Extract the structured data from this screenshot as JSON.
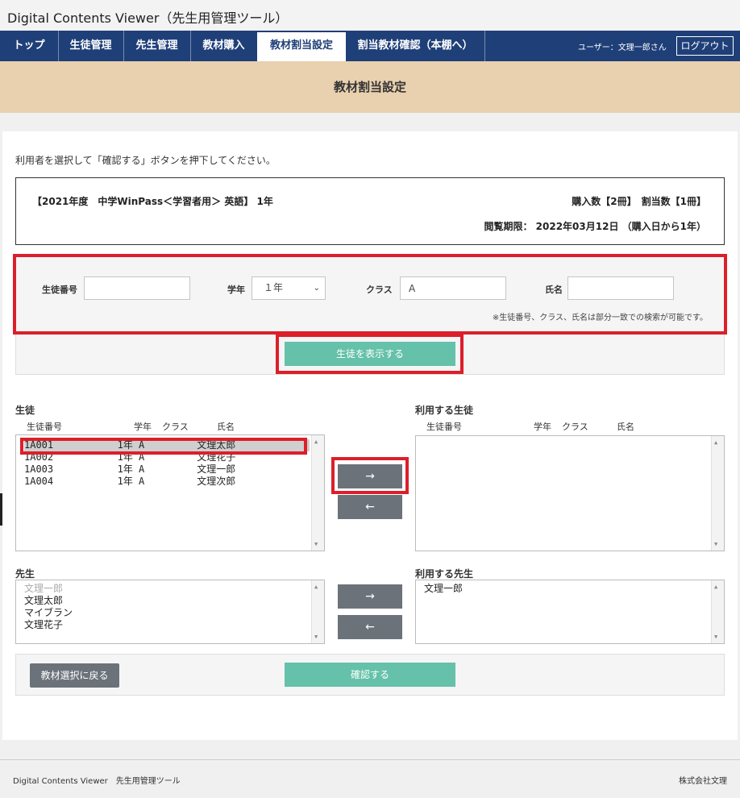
{
  "app": {
    "title": "Digital Contents Viewer（先生用管理ツール）"
  },
  "nav": {
    "items": [
      "トップ",
      "生徒管理",
      "先生管理",
      "教材購入",
      "教材割当設定",
      "割当教材確認（本棚へ）"
    ],
    "user": "ユーザー：文理一郎さん",
    "logout": "ログアウト"
  },
  "page": {
    "header": "教材割当設定"
  },
  "instruction": "利用者を選択して「確認する」ボタンを押下してください。",
  "material": {
    "title": "【2021年度　中学WinPass＜学習者用＞ 英語】 1年",
    "counts": "購入数【2冊】　割当数【1冊】",
    "period": "閲覧期限： 2022年03月12日 （購入日から1年）"
  },
  "search": {
    "student_no_label": "生徒番号",
    "student_no_value": "",
    "grade_label": "学年",
    "grade_value": "１年",
    "class_label": "クラス",
    "class_value": "A",
    "name_label": "氏名",
    "name_value": "",
    "note": "※生徒番号、クラス、氏名は部分一致での検索が可能です。",
    "show_button": "生徒を表示する"
  },
  "students": {
    "title": "生徒",
    "headers": [
      "生徒番号",
      "学年",
      "クラス",
      "氏名"
    ],
    "rows": [
      "1A001           1年 A         文理太郎",
      "1A002           1年 A         文理花子",
      "1A003           1年 A         文理一郎",
      "1A004           1年 A         文理次郎"
    ]
  },
  "using_students": {
    "title": "利用する生徒",
    "headers": [
      "生徒番号",
      "学年",
      "クラス",
      "氏名"
    ]
  },
  "teachers": {
    "title": "先生",
    "rows": [
      "文理一郎",
      "文理太郎",
      "マイブラン",
      "文理花子"
    ]
  },
  "using_teachers": {
    "title": "利用する先生",
    "rows": [
      "文理一郎"
    ]
  },
  "arrows": {
    "right": "→",
    "left": "←"
  },
  "bottom": {
    "back": "教材選択に戻る",
    "confirm": "確認する"
  },
  "footer": {
    "left": "Digital Contents Viewer　先生用管理ツール",
    "right": "株式会社文理"
  },
  "colors": {
    "nav": "#1f3f78",
    "header": "#e9d1af",
    "green": "#65c1a9",
    "highlight": "#dc1f2a",
    "gray_button": "#6b727a"
  }
}
